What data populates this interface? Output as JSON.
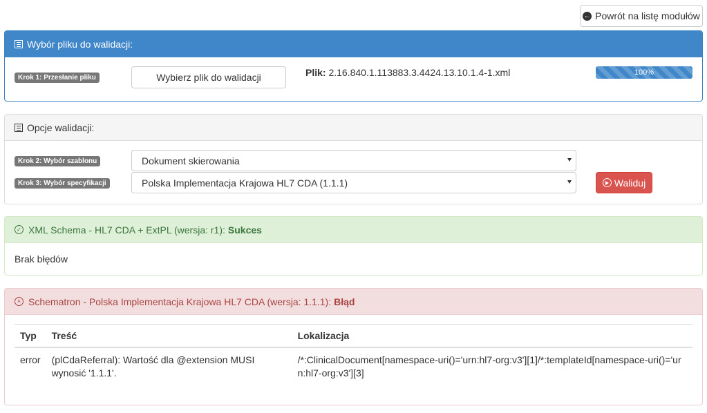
{
  "back_button": {
    "label": "Powrót na listę modułów",
    "icon": "arrow-left-circle-icon"
  },
  "file_panel": {
    "title": "Wybór pliku do walidacji:",
    "step1_label": "Krok 1: Przesłanie pliku",
    "choose_file_button": "Wybierz plik do walidacji",
    "file_prefix": "Plik:",
    "file_name": "2.16.840.1.113883.3.4424.13.10.1.4-1.xml",
    "progress_text": "100%",
    "progress_percent": 100
  },
  "options_panel": {
    "title": "Opcje walidacji:",
    "step2_label": "Krok 2: Wybór szablonu",
    "template_value": "Dokument skierowania",
    "step3_label": "Krok 3: Wybór specyfikacji",
    "spec_value": "Polska Implementacja Krajowa HL7 CDA (1.1.1)",
    "validate_button": "Waliduj"
  },
  "schema_result": {
    "title": "XML Schema - HL7 CDA + ExtPL (wersja: r1):",
    "status": "Sukces",
    "body": "Brak błędów"
  },
  "schematron_result": {
    "title": "Schematron - Polska Implementacja Krajowa HL7 CDA (wersja: 1.1.1):",
    "status": "Błąd",
    "columns": {
      "type": "Typ",
      "content": "Treść",
      "location": "Lokalizacja"
    },
    "rows": [
      {
        "type": "error",
        "content": "(plCdaReferral): Wartość dla @extension MUSI wynosić '1.1.1'.",
        "location": "/*:ClinicalDocument[namespace-uri()='urn:hl7-org:v3'][1]/*:templateId[namespace-uri()='urn:hl7-org:v3'][3]"
      }
    ]
  },
  "colors": {
    "primary": "#3f87c9",
    "success_bg": "#dff0d8",
    "success_text": "#3c763d",
    "danger_bg": "#f2dede",
    "danger_text": "#a94442",
    "danger_button": "#d9534f",
    "label_gray": "#777777"
  }
}
